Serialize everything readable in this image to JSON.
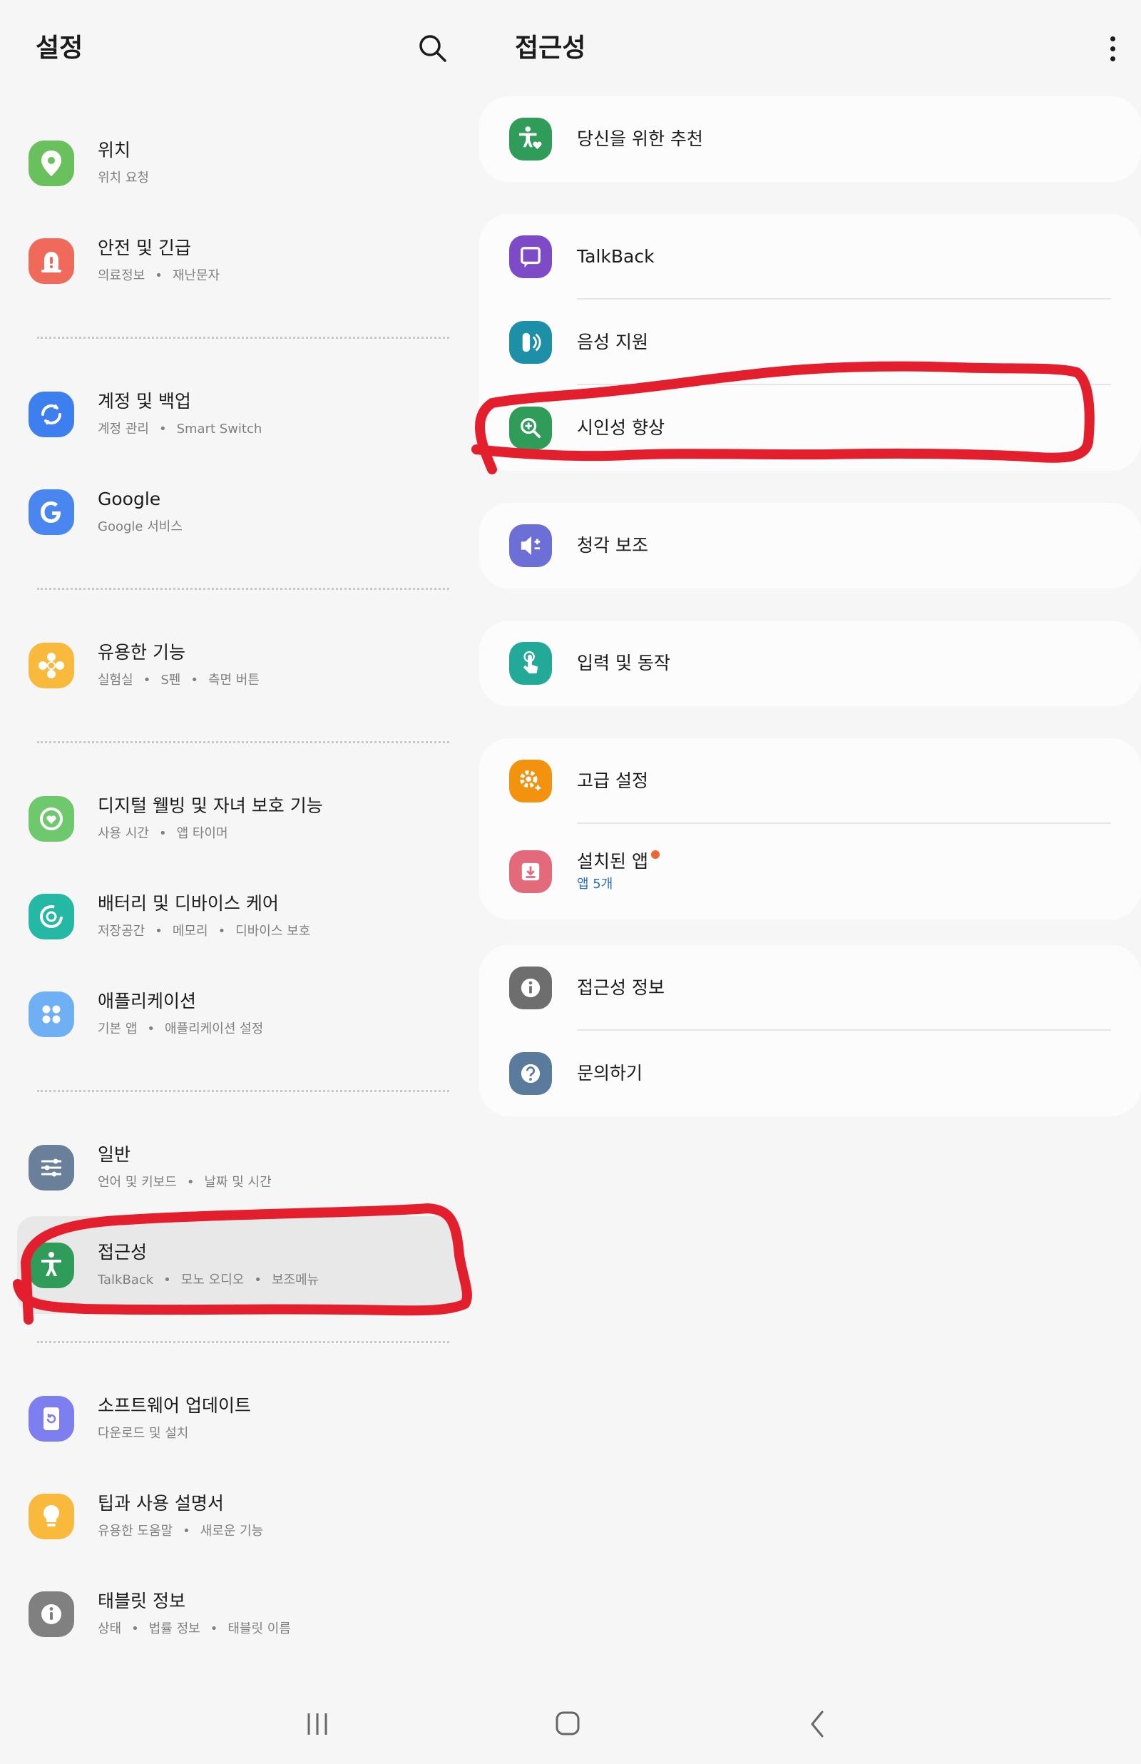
{
  "left_panel": {
    "title": "설정",
    "search_icon": "search-icon",
    "groups": [
      {
        "items": [
          {
            "title": "위치",
            "subtitle": [
              "위치 요청"
            ],
            "icon": "location-icon",
            "color": "#69c05c"
          },
          {
            "title": "안전 및 긴급",
            "subtitle": [
              "의료정보",
              "재난문자"
            ],
            "icon": "alert-icon",
            "color": "#f06a5b"
          }
        ]
      },
      {
        "items": [
          {
            "title": "계정 및 백업",
            "subtitle": [
              "계정 관리",
              "Smart Switch"
            ],
            "icon": "sync-icon",
            "color": "#3e7fef"
          },
          {
            "title": "Google",
            "subtitle": [
              "Google 서비스"
            ],
            "icon": "google-icon",
            "color": "#4a86f0"
          }
        ]
      },
      {
        "items": [
          {
            "title": "유용한 기능",
            "subtitle": [
              "실험실",
              "S펜",
              "측면 버튼"
            ],
            "icon": "puzzle-icon",
            "color": "#f9b93d"
          }
        ]
      },
      {
        "items": [
          {
            "title": "디지털 웰빙 및 자녀 보호 기능",
            "subtitle": [
              "사용 시간",
              "앱 타이머"
            ],
            "icon": "wellbeing-icon",
            "color": "#6dc96b"
          },
          {
            "title": "배터리 및 디바이스 케어",
            "subtitle": [
              "저장공간",
              "메모리",
              "디바이스 보호"
            ],
            "icon": "device-care-icon",
            "color": "#24b8a5"
          },
          {
            "title": "애플리케이션",
            "subtitle": [
              "기본 앱",
              "애플리케이션 설정"
            ],
            "icon": "apps-grid-icon",
            "color": "#6fb0f5"
          }
        ]
      },
      {
        "items": [
          {
            "title": "일반",
            "subtitle": [
              "언어 및 키보드",
              "날짜 및 시간"
            ],
            "icon": "sliders-icon",
            "color": "#6a7f99"
          },
          {
            "title": "접근성",
            "subtitle": [
              "TalkBack",
              "모노 오디오",
              "보조메뉴"
            ],
            "icon": "accessibility-icon",
            "color": "#2f9c5a",
            "selected": true
          }
        ]
      },
      {
        "items": [
          {
            "title": "소프트웨어 업데이트",
            "subtitle": [
              "다운로드 및 설치"
            ],
            "icon": "update-icon",
            "color": "#7d7ef0"
          },
          {
            "title": "팁과 사용 설명서",
            "subtitle": [
              "유용한 도움말",
              "새로운 기능"
            ],
            "icon": "lightbulb-icon",
            "color": "#f9b93d"
          },
          {
            "title": "태블릿 정보",
            "subtitle": [
              "상태",
              "법률 정보",
              "태블릿 이름"
            ],
            "icon": "info-icon",
            "color": "#808080"
          }
        ]
      }
    ]
  },
  "right_panel": {
    "title": "접근성",
    "more_icon": "more-vertical-icon",
    "cards": [
      {
        "items": [
          {
            "title": "당신을 위한 추천",
            "icon": "accessibility-heart-icon",
            "color": "#2f9c5a"
          }
        ]
      },
      {
        "items": [
          {
            "title": "TalkBack",
            "icon": "talkback-icon",
            "color": "#7d4bc6"
          },
          {
            "title": "음성 지원",
            "icon": "voice-assist-icon",
            "color": "#1d8fa6"
          },
          {
            "title": "시인성 향상",
            "icon": "zoom-in-icon",
            "color": "#2f9c5a"
          }
        ]
      },
      {
        "items": [
          {
            "title": "청각 보조",
            "icon": "hearing-icon",
            "color": "#6c6fd6"
          }
        ]
      },
      {
        "items": [
          {
            "title": "입력 및 동작",
            "icon": "touch-icon",
            "color": "#23a998"
          }
        ]
      },
      {
        "items": [
          {
            "title": "고급 설정",
            "icon": "gear-plus-icon",
            "color": "#f2920f"
          },
          {
            "title": "설치된 앱",
            "subtitle": "앱 5개",
            "icon": "download-icon",
            "color": "#e26a7a",
            "badge": true
          }
        ]
      },
      {
        "items": [
          {
            "title": "접근성 정보",
            "icon": "info-icon",
            "color": "#6e6e6e"
          },
          {
            "title": "문의하기",
            "icon": "help-icon",
            "color": "#5a7b9c"
          }
        ]
      }
    ]
  },
  "nav_bar": {
    "recents_icon": "recents-icon",
    "home_icon": "home-icon",
    "back_icon": "back-icon"
  },
  "annotations": {
    "color": "#e41f2d",
    "targets": [
      "접근성",
      "시인성 향상"
    ]
  }
}
